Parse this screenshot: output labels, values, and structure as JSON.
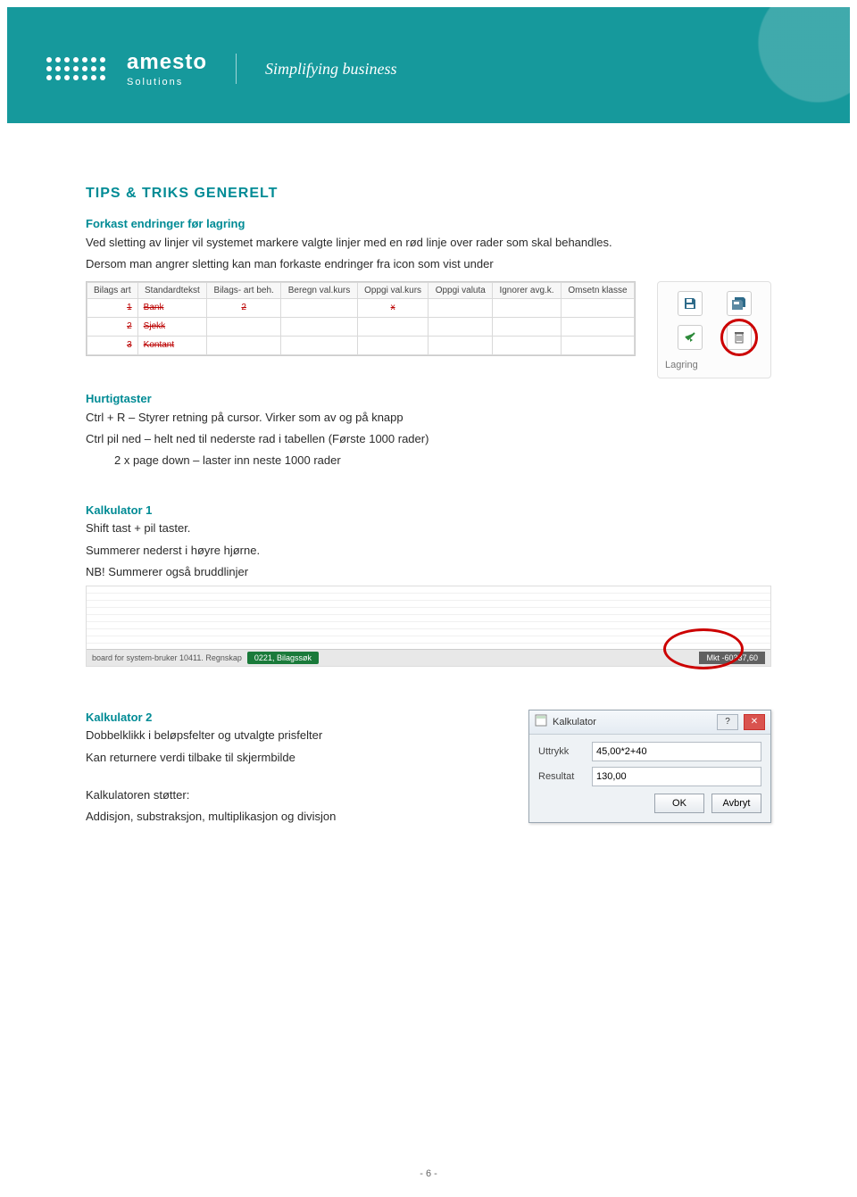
{
  "brand": {
    "name": "amesto",
    "sub": "Solutions",
    "tag": "Simplifying business"
  },
  "heading": "TIPS & TRIKS GENERELT",
  "sec1": {
    "title": "Forkast endringer før lagring",
    "p1": "Ved sletting av linjer vil systemet markere valgte linjer med en rød linje over rader som skal behandles.",
    "p2": "Dersom man angrer sletting kan man forkaste endringer fra icon som vist under"
  },
  "table": {
    "headers": [
      "Bilags\nart",
      "Standardtekst",
      "Bilags-\nart beh.",
      "Beregn\nval.kurs",
      "Oppgi\nval.kurs",
      "Oppgi\nvaluta",
      "Ignorer\navg.k.",
      "Omsetn\nklasse"
    ],
    "rows": [
      {
        "strike": true,
        "cells": [
          "1",
          "Bank",
          "2",
          "",
          "x",
          "",
          "",
          ""
        ]
      },
      {
        "strike": true,
        "cells": [
          "2",
          "Sjekk",
          "",
          "",
          "",
          "",
          "",
          ""
        ]
      },
      {
        "strike": true,
        "cells": [
          "3",
          "Kontant",
          "",
          "",
          "",
          "",
          "",
          ""
        ]
      }
    ]
  },
  "iconpanel": {
    "label": "Lagring"
  },
  "sec2": {
    "title": "Hurtigtaster",
    "l1": "Ctrl + R – Styrer retning på cursor. Virker som av og på knapp",
    "l2": "Ctrl pil ned – helt ned til nederste rad i tabellen (Første 1000 rader)",
    "l3": "2 x page down – laster inn neste 1000 rader"
  },
  "sec3": {
    "title": "Kalkulator 1",
    "l1": "Shift tast + pil taster.",
    "l2": "Summerer nederst i høyre hjørne.",
    "l3": "NB! Summerer også bruddlinjer"
  },
  "status": {
    "left": "board for system-bruker  10411. Regnskap",
    "tag": "0221, Bilagssøk",
    "right": "Mkt -60337,60"
  },
  "sec4": {
    "title": "Kalkulator 2",
    "l1": "Dobbelklikk i beløpsfelter og utvalgte prisfelter",
    "l2": "Kan returnere verdi tilbake til skjermbilde",
    "l3": "Kalkulatoren støtter:",
    "l4": "Addisjon, substraksjon, multiplikasjon og divisjon"
  },
  "calc": {
    "title": "Kalkulator",
    "uttrykk_label": "Uttrykk",
    "uttrykk_value": "45,00*2+40",
    "resultat_label": "Resultat",
    "resultat_value": "130,00",
    "ok": "OK",
    "cancel": "Avbryt"
  },
  "pagenum": "- 6 -"
}
